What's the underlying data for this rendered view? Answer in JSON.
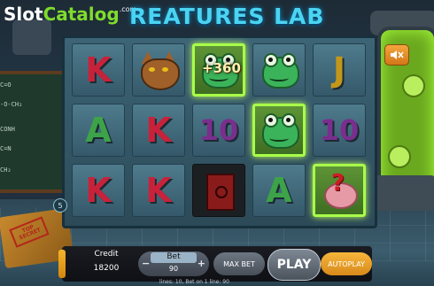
{
  "brand": {
    "slot": "Slot",
    "catalog": "Catalog",
    "com": ".com"
  },
  "game": {
    "title": "REATURES LAB"
  },
  "chalkboard": {
    "lines": [
      "C=O",
      "-O-CH₂",
      "CONH",
      "C=N",
      "CH₂"
    ]
  },
  "book": {
    "stamp": "TOP SECRET"
  },
  "reels": [
    [
      {
        "kind": "letter",
        "text": "K",
        "cls": "l-K"
      },
      {
        "kind": "letter",
        "text": "A",
        "cls": "l-A"
      },
      {
        "kind": "letter",
        "text": "K",
        "cls": "l-K"
      }
    ],
    [
      {
        "kind": "cat"
      },
      {
        "kind": "letter",
        "text": "K",
        "cls": "l-K"
      },
      {
        "kind": "letter",
        "text": "K",
        "cls": "l-K"
      }
    ],
    [
      {
        "kind": "frog",
        "win": true,
        "amount": "+360"
      },
      {
        "kind": "letter",
        "text": "10",
        "cls": "l-10"
      },
      {
        "kind": "safe"
      }
    ],
    [
      {
        "kind": "frog"
      },
      {
        "kind": "frog",
        "win": true
      },
      {
        "kind": "letter",
        "text": "A",
        "cls": "l-A"
      }
    ],
    [
      {
        "kind": "letter",
        "text": "J",
        "cls": "l-J"
      },
      {
        "kind": "letter",
        "text": "10",
        "cls": "l-10"
      },
      {
        "kind": "brain",
        "win": true
      }
    ]
  ],
  "line_marker": "5",
  "controls": {
    "credit_label": "Credit",
    "credit_value": "18200",
    "bet_label": "Bet",
    "bet_value": "90",
    "bet_minus": "−",
    "bet_plus": "+",
    "max_bet": "MAX BET",
    "play": "PLAY",
    "autoplay": "AUTOPLAY",
    "lines_info": "lines: 10,  Bet on 1 line: 90"
  },
  "icons": {
    "sound": "mute-speaker-icon"
  },
  "colors": {
    "accent": "#f5b52a",
    "win_border": "#a8ff4a",
    "title": "#4ad4f2"
  }
}
